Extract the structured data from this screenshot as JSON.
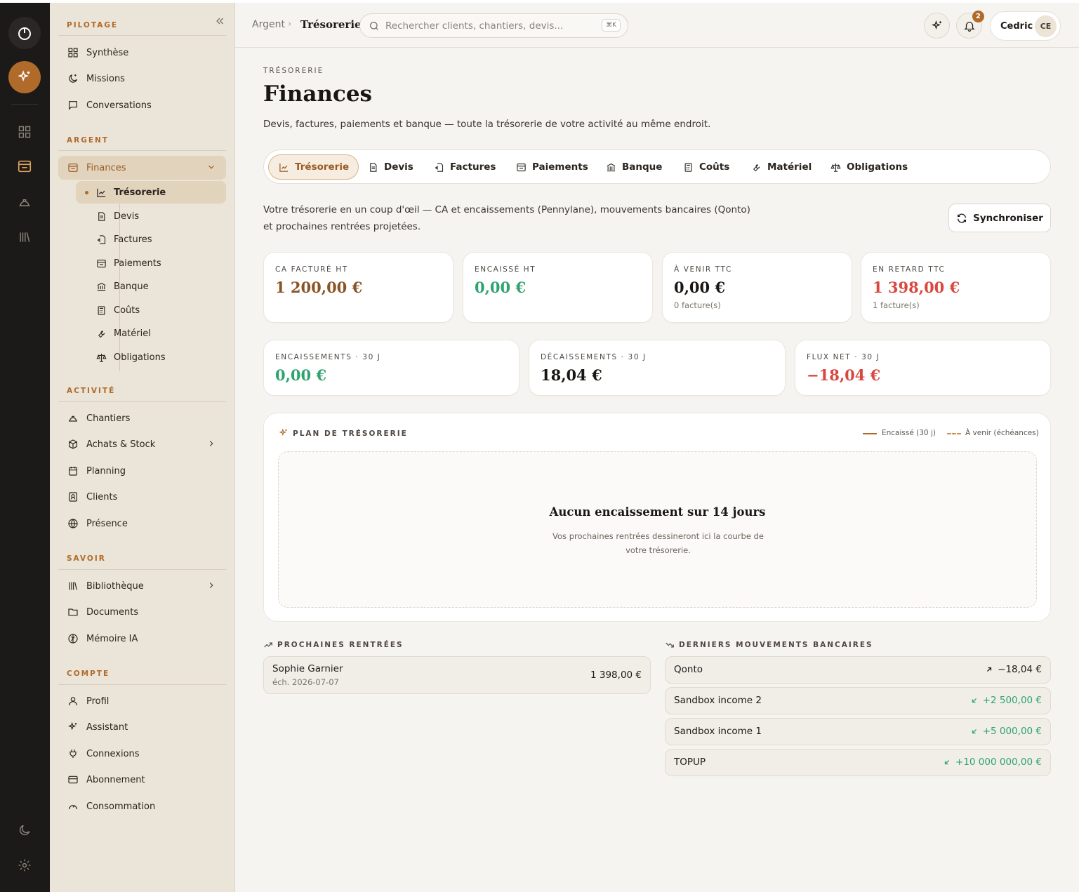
{
  "header": {
    "breadcrumb": [
      "Argent",
      "Trésorerie"
    ],
    "search_placeholder": "Rechercher clients, chantiers, devis...",
    "shortcut": "⌘K",
    "notification_count": "2",
    "user_name": "Cedric",
    "user_initials": "CE"
  },
  "sidebar": {
    "sections": [
      "PILOTAGE",
      "ARGENT",
      "ACTIVITÉ",
      "SAVOIR",
      "COMPTE"
    ],
    "pilotage": [
      "Synthèse",
      "Missions",
      "Conversations"
    ],
    "argent": {
      "finances": "Finances",
      "sub": [
        "Trésorerie",
        "Devis",
        "Factures",
        "Paiements",
        "Banque",
        "Coûts",
        "Matériel",
        "Obligations"
      ]
    },
    "activite": [
      "Chantiers",
      "Achats & Stock",
      "Planning",
      "Clients",
      "Présence"
    ],
    "savoir": [
      "Bibliothèque",
      "Documents",
      "Mémoire IA"
    ],
    "compte": [
      "Profil",
      "Assistant",
      "Connexions",
      "Abonnement",
      "Consommation"
    ]
  },
  "page": {
    "eyebrow": "TRÉSORERIE",
    "title": "Finances",
    "subtitle": "Devis, factures, paiements et banque — toute la trésorerie de votre activité au même endroit.",
    "tabs": [
      "Trésorerie",
      "Devis",
      "Factures",
      "Paiements",
      "Banque",
      "Coûts",
      "Matériel",
      "Obligations"
    ],
    "intro_line1": "Votre trésorerie en un coup d'œil — CA et encaissements (Pennylane), mouvements bancaires (Qonto)",
    "intro_line2": "et prochaines rentrées projetées.",
    "sync_label": "Synchroniser"
  },
  "kpis_top": [
    {
      "label": "CA FACTURÉ HT",
      "value": "1 200,00 €",
      "sub": ""
    },
    {
      "label": "ENCAISSÉ HT",
      "value": "0,00 €",
      "sub": ""
    },
    {
      "label": "À VENIR TTC",
      "value": "0,00 €",
      "sub": "0 facture(s)"
    },
    {
      "label": "EN RETARD TTC",
      "value": "1 398,00 €",
      "sub": "1 facture(s)"
    }
  ],
  "kpis_bottom": [
    {
      "label": "ENCAISSEMENTS · 30 J",
      "value": "0,00 €"
    },
    {
      "label": "DÉCAISSEMENTS · 30 J",
      "value": "18,04 €"
    },
    {
      "label": "FLUX NET · 30 J",
      "value": "−18,04 €"
    }
  ],
  "plan": {
    "title": "PLAN DE TRÉSORERIE",
    "legend_paid": "Encaissé (30 j)",
    "legend_upcoming": "À venir (échéances)",
    "empty_title": "Aucun encaissement sur 14 jours",
    "empty_sub": "Vos prochaines rentrées dessineront ici la courbe de votre trésorerie."
  },
  "upcoming": {
    "title": "PROCHAINES RENTRÉES",
    "items": [
      {
        "name": "Sophie Garnier",
        "due": "éch. 2026-07-07",
        "amount": "1 398,00 €"
      }
    ]
  },
  "bank": {
    "title": "DERNIERS MOUVEMENTS BANCAIRES",
    "items": [
      {
        "name": "Qonto",
        "amount": "−18,04 €",
        "direction": "out"
      },
      {
        "name": "Sandbox income 2",
        "amount": "+2 500,00 €",
        "direction": "in"
      },
      {
        "name": "Sandbox income 1",
        "amount": "+5 000,00 €",
        "direction": "in"
      },
      {
        "name": "TOPUP",
        "amount": "+10 000 000,00 €",
        "direction": "in"
      }
    ]
  },
  "colors": {
    "accent": "#b06a2a",
    "positive": "#2fa36f",
    "negative": "#d9473e",
    "rail": "#1c1a18",
    "sidebar": "#ebe4d8"
  }
}
